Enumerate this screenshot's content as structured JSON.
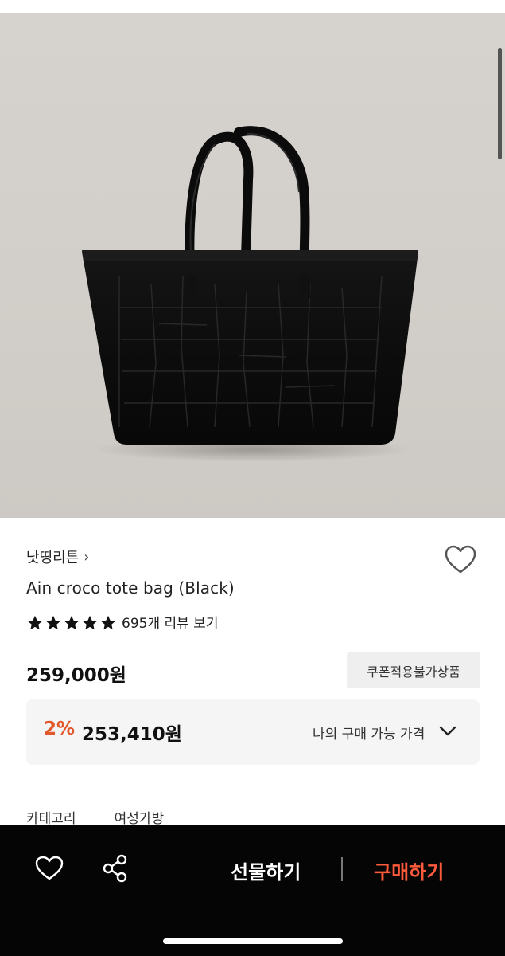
{
  "product": {
    "brand": "낫띵리튼",
    "brand_chevron": "›",
    "title": "Ain croco tote bag (Black)",
    "rating_stars": 5,
    "review_link": "695개 리뷰 보기",
    "price": "259,000원",
    "coupon_badge": "쿠폰적용불가상품",
    "my_price": {
      "discount_rate": "2%",
      "price": "253,410원",
      "label": "나의 구매 가능 가격"
    },
    "category": {
      "label": "카테고리",
      "value": "여성가방"
    }
  },
  "bottom_bar": {
    "gift_label": "선물하기",
    "buy_label": "구매하기"
  },
  "colors": {
    "accent": "#e2582a",
    "buy": "#ff5a3c",
    "bottom_bar_bg": "#050505"
  },
  "icons": [
    "heart-icon",
    "chevron-right-icon",
    "star-icon",
    "chevron-down-icon",
    "share-icon"
  ]
}
